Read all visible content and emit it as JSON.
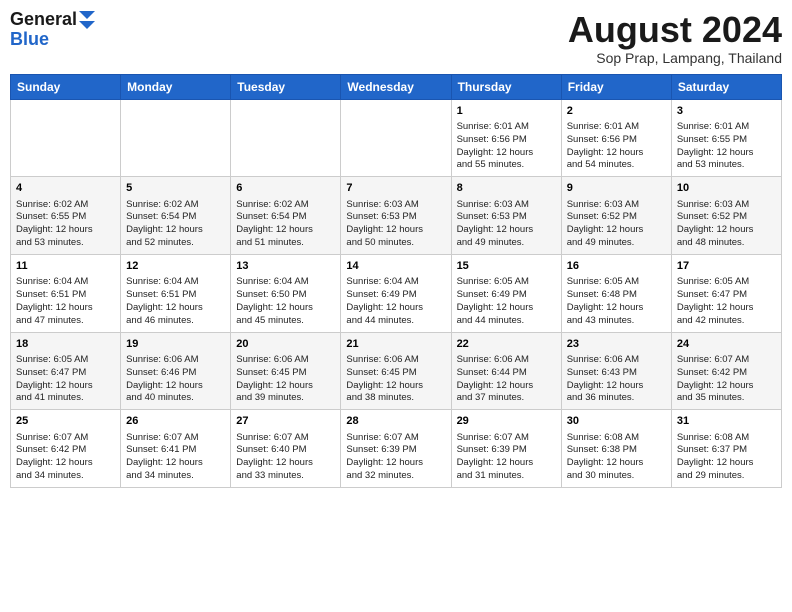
{
  "header": {
    "logo_line1": "General",
    "logo_line2": "Blue",
    "month": "August 2024",
    "location": "Sop Prap, Lampang, Thailand"
  },
  "weekdays": [
    "Sunday",
    "Monday",
    "Tuesday",
    "Wednesday",
    "Thursday",
    "Friday",
    "Saturday"
  ],
  "weeks": [
    [
      {
        "day": "",
        "info": ""
      },
      {
        "day": "",
        "info": ""
      },
      {
        "day": "",
        "info": ""
      },
      {
        "day": "",
        "info": ""
      },
      {
        "day": "1",
        "info": "Sunrise: 6:01 AM\nSunset: 6:56 PM\nDaylight: 12 hours\nand 55 minutes."
      },
      {
        "day": "2",
        "info": "Sunrise: 6:01 AM\nSunset: 6:56 PM\nDaylight: 12 hours\nand 54 minutes."
      },
      {
        "day": "3",
        "info": "Sunrise: 6:01 AM\nSunset: 6:55 PM\nDaylight: 12 hours\nand 53 minutes."
      }
    ],
    [
      {
        "day": "4",
        "info": "Sunrise: 6:02 AM\nSunset: 6:55 PM\nDaylight: 12 hours\nand 53 minutes."
      },
      {
        "day": "5",
        "info": "Sunrise: 6:02 AM\nSunset: 6:54 PM\nDaylight: 12 hours\nand 52 minutes."
      },
      {
        "day": "6",
        "info": "Sunrise: 6:02 AM\nSunset: 6:54 PM\nDaylight: 12 hours\nand 51 minutes."
      },
      {
        "day": "7",
        "info": "Sunrise: 6:03 AM\nSunset: 6:53 PM\nDaylight: 12 hours\nand 50 minutes."
      },
      {
        "day": "8",
        "info": "Sunrise: 6:03 AM\nSunset: 6:53 PM\nDaylight: 12 hours\nand 49 minutes."
      },
      {
        "day": "9",
        "info": "Sunrise: 6:03 AM\nSunset: 6:52 PM\nDaylight: 12 hours\nand 49 minutes."
      },
      {
        "day": "10",
        "info": "Sunrise: 6:03 AM\nSunset: 6:52 PM\nDaylight: 12 hours\nand 48 minutes."
      }
    ],
    [
      {
        "day": "11",
        "info": "Sunrise: 6:04 AM\nSunset: 6:51 PM\nDaylight: 12 hours\nand 47 minutes."
      },
      {
        "day": "12",
        "info": "Sunrise: 6:04 AM\nSunset: 6:51 PM\nDaylight: 12 hours\nand 46 minutes."
      },
      {
        "day": "13",
        "info": "Sunrise: 6:04 AM\nSunset: 6:50 PM\nDaylight: 12 hours\nand 45 minutes."
      },
      {
        "day": "14",
        "info": "Sunrise: 6:04 AM\nSunset: 6:49 PM\nDaylight: 12 hours\nand 44 minutes."
      },
      {
        "day": "15",
        "info": "Sunrise: 6:05 AM\nSunset: 6:49 PM\nDaylight: 12 hours\nand 44 minutes."
      },
      {
        "day": "16",
        "info": "Sunrise: 6:05 AM\nSunset: 6:48 PM\nDaylight: 12 hours\nand 43 minutes."
      },
      {
        "day": "17",
        "info": "Sunrise: 6:05 AM\nSunset: 6:47 PM\nDaylight: 12 hours\nand 42 minutes."
      }
    ],
    [
      {
        "day": "18",
        "info": "Sunrise: 6:05 AM\nSunset: 6:47 PM\nDaylight: 12 hours\nand 41 minutes."
      },
      {
        "day": "19",
        "info": "Sunrise: 6:06 AM\nSunset: 6:46 PM\nDaylight: 12 hours\nand 40 minutes."
      },
      {
        "day": "20",
        "info": "Sunrise: 6:06 AM\nSunset: 6:45 PM\nDaylight: 12 hours\nand 39 minutes."
      },
      {
        "day": "21",
        "info": "Sunrise: 6:06 AM\nSunset: 6:45 PM\nDaylight: 12 hours\nand 38 minutes."
      },
      {
        "day": "22",
        "info": "Sunrise: 6:06 AM\nSunset: 6:44 PM\nDaylight: 12 hours\nand 37 minutes."
      },
      {
        "day": "23",
        "info": "Sunrise: 6:06 AM\nSunset: 6:43 PM\nDaylight: 12 hours\nand 36 minutes."
      },
      {
        "day": "24",
        "info": "Sunrise: 6:07 AM\nSunset: 6:42 PM\nDaylight: 12 hours\nand 35 minutes."
      }
    ],
    [
      {
        "day": "25",
        "info": "Sunrise: 6:07 AM\nSunset: 6:42 PM\nDaylight: 12 hours\nand 34 minutes."
      },
      {
        "day": "26",
        "info": "Sunrise: 6:07 AM\nSunset: 6:41 PM\nDaylight: 12 hours\nand 34 minutes."
      },
      {
        "day": "27",
        "info": "Sunrise: 6:07 AM\nSunset: 6:40 PM\nDaylight: 12 hours\nand 33 minutes."
      },
      {
        "day": "28",
        "info": "Sunrise: 6:07 AM\nSunset: 6:39 PM\nDaylight: 12 hours\nand 32 minutes."
      },
      {
        "day": "29",
        "info": "Sunrise: 6:07 AM\nSunset: 6:39 PM\nDaylight: 12 hours\nand 31 minutes."
      },
      {
        "day": "30",
        "info": "Sunrise: 6:08 AM\nSunset: 6:38 PM\nDaylight: 12 hours\nand 30 minutes."
      },
      {
        "day": "31",
        "info": "Sunrise: 6:08 AM\nSunset: 6:37 PM\nDaylight: 12 hours\nand 29 minutes."
      }
    ]
  ]
}
